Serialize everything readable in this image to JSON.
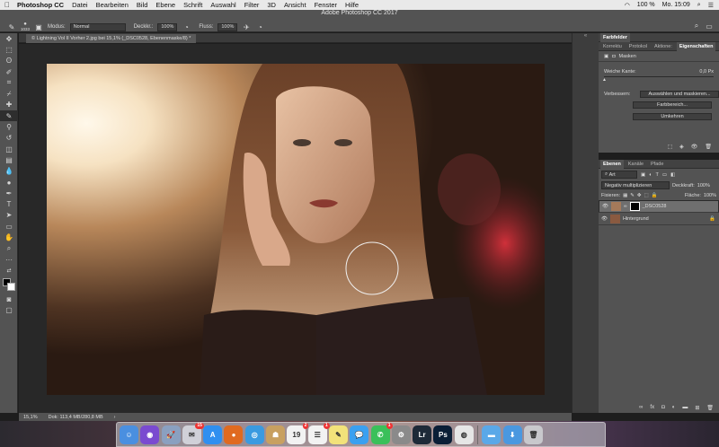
{
  "menubar": {
    "apple": "",
    "app_name": "Photoshop CC",
    "items": [
      "Datei",
      "Bearbeiten",
      "Bild",
      "Ebene",
      "Schrift",
      "Auswahl",
      "Filter",
      "3D",
      "Ansicht",
      "Fenster",
      "Hilfe"
    ],
    "battery": "100 %",
    "clock": "Mo. 15:09"
  },
  "window": {
    "title": "Adobe Photoshop CC 2017"
  },
  "options": {
    "brush_size": "1033",
    "mode_label": "Modus:",
    "mode_value": "Normal",
    "opacity_label": "Deckkr.:",
    "opacity_value": "100%",
    "flow_label": "Fluss:",
    "flow_value": "100%"
  },
  "document": {
    "tab_title": "© Lightning Vol II Vorher 2.jpg bei 15,1% (_DSC0528, Ebenenmaske/8) *",
    "zoom": "15,1%",
    "doc_info": "Dok: 113,4 MB/280,8 MB"
  },
  "properties_panel": {
    "tabs_top": [
      "Farbfelder"
    ],
    "tabs": [
      "Korrektu",
      "Protokol",
      "Aktione:",
      "Eigenschaften"
    ],
    "mask_label": "Masken",
    "feather_label": "Weiche Kante:",
    "feather_value": "0,0 Px",
    "refine_label": "Verbessern:",
    "btn_select_mask": "Auswählen und maskieren...",
    "btn_color_range": "Farbbereich...",
    "btn_invert": "Umkehren"
  },
  "layers_panel": {
    "tabs": [
      "Ebenen",
      "Kanäle",
      "Pfade"
    ],
    "filter_label": "Art",
    "blend_mode": "Negativ multiplizieren",
    "opacity_label": "Deckkraft:",
    "opacity_value": "100%",
    "lock_label": "Fixieren:",
    "fill_label": "Fläche:",
    "fill_value": "100%",
    "layers": [
      {
        "name": "_DSC0528",
        "selected": true
      },
      {
        "name": "Hintergrund",
        "selected": false
      }
    ]
  },
  "dock": {
    "icons": [
      {
        "name": "finder-icon",
        "color": "#4a8fe0",
        "glyph": "☺"
      },
      {
        "name": "siri-icon",
        "color": "#7a4ad0",
        "glyph": "◉"
      },
      {
        "name": "launchpad-icon",
        "color": "#8aa0c0",
        "glyph": "🚀"
      },
      {
        "name": "mail-icon",
        "color": "#d0d0d8",
        "glyph": "✉",
        "badge": "15"
      },
      {
        "name": "appstore-icon",
        "color": "#2f8ff0",
        "glyph": "A"
      },
      {
        "name": "firefox-icon",
        "color": "#e06a20",
        "glyph": "●"
      },
      {
        "name": "safari-icon",
        "color": "#3a9ae0",
        "glyph": "◎"
      },
      {
        "name": "contacts-icon",
        "color": "#c8a060",
        "glyph": "☗"
      },
      {
        "name": "calendar-icon",
        "color": "#f2f2f2",
        "glyph": "19",
        "badge": "2"
      },
      {
        "name": "reminders-icon",
        "color": "#f2f2f2",
        "glyph": "☰",
        "badge": "1"
      },
      {
        "name": "notes-icon",
        "color": "#f2e27a",
        "glyph": "✎"
      },
      {
        "name": "messages-icon",
        "color": "#3aa0f0",
        "glyph": "💬"
      },
      {
        "name": "whatsapp-icon",
        "color": "#3ac05a",
        "glyph": "✆",
        "badge": "1"
      },
      {
        "name": "system-preferences-icon",
        "color": "#8a8a8a",
        "glyph": "⚙"
      },
      {
        "name": "lightroom-icon",
        "color": "#1e2a38",
        "glyph": "Lr"
      },
      {
        "name": "photoshop-icon",
        "color": "#0a1e36",
        "glyph": "Ps"
      },
      {
        "name": "chrome-icon",
        "color": "#e6e6e6",
        "glyph": "◍"
      }
    ],
    "right_icons": [
      {
        "name": "folder-icon",
        "color": "#5aa8e8",
        "glyph": "▬"
      },
      {
        "name": "downloads-icon",
        "color": "#4a98e0",
        "glyph": "⬇"
      },
      {
        "name": "trash-icon",
        "color": "#c8c8cc",
        "glyph": "🗑"
      }
    ]
  }
}
